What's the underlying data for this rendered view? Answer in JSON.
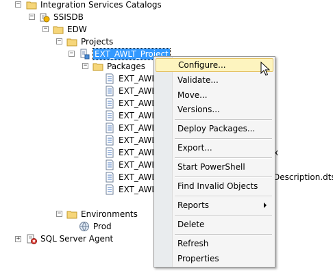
{
  "tree": {
    "integration_services_catalogs": "Integration Services Catalogs",
    "ssisdb": "SSISDB",
    "edw": "EDW",
    "projects": "Projects",
    "project": "EXT_AWLT_Project",
    "packages": "Packages",
    "package_items": [
      "EXT_AWL",
      "EXT_AWL",
      "EXT_AWL",
      "EXT_AWL",
      "EXT_AWL",
      "EXT_AWL",
      "EXT_AWL",
      "EXT_AWL",
      "EXT_AWL",
      "EXT_AWL"
    ],
    "partial_text_1": "x",
    "partial_text_2": "Description.dtsx",
    "environments": "Environments",
    "prod": "Prod",
    "sql_server_agent": "SQL Server Agent"
  },
  "context_menu": {
    "configure": "Configure...",
    "validate": "Validate...",
    "move": "Move...",
    "versions": "Versions...",
    "deploy_packages": "Deploy Packages...",
    "export": "Export...",
    "start_powershell": "Start PowerShell",
    "find_invalid_objects": "Find Invalid Objects",
    "reports": "Reports",
    "delete": "Delete",
    "refresh": "Refresh",
    "properties": "Properties"
  },
  "icons": {
    "folder": "folder-icon",
    "database": "ssisdb-icon",
    "project": "project-icon",
    "package": "package-icon",
    "environment": "environment-icon",
    "agent": "sql-agent-icon"
  }
}
